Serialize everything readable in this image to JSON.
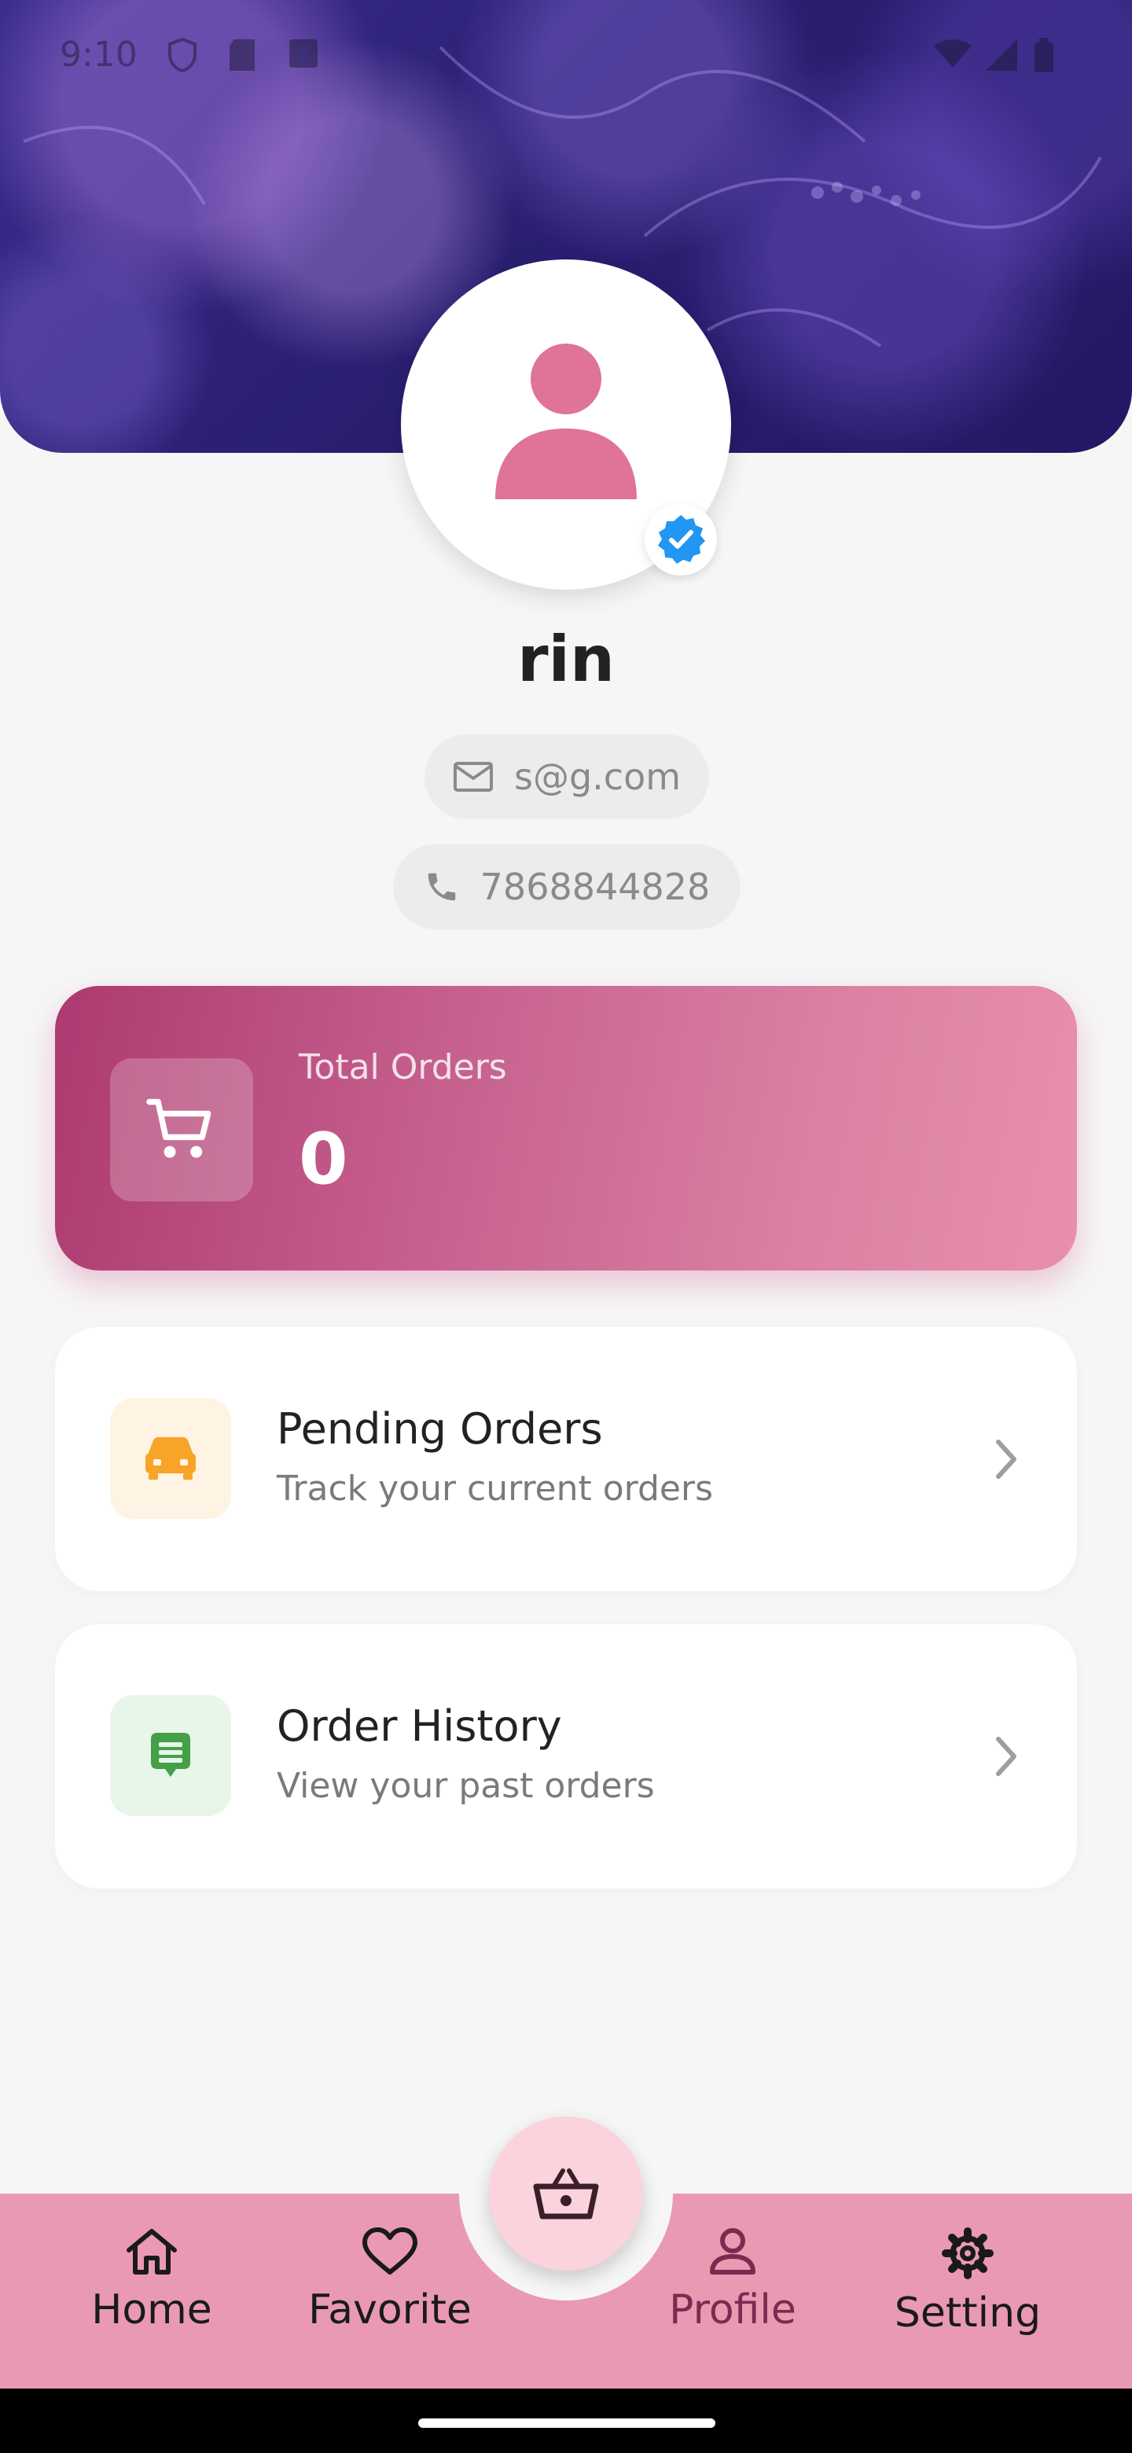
{
  "status_bar": {
    "time": "9:10"
  },
  "profile": {
    "name": "rin",
    "email": "s@g.com",
    "phone": "7868844828"
  },
  "total_orders": {
    "label": "Total Orders",
    "value": "0"
  },
  "menu": [
    {
      "title": "Pending Orders",
      "subtitle": "Track your current orders",
      "icon": "car-icon",
      "icon_color": "#f7a428",
      "icon_bg": "#fff3e3"
    },
    {
      "title": "Order History",
      "subtitle": "View your past orders",
      "icon": "receipt-icon",
      "icon_color": "#43a047",
      "icon_bg": "#e8f5e9"
    }
  ],
  "bottom_nav": {
    "items": [
      {
        "label": "Home",
        "icon": "home-icon"
      },
      {
        "label": "Favorite",
        "icon": "heart-icon"
      },
      {
        "label": "Profile",
        "icon": "person-icon",
        "active": true
      },
      {
        "label": "Setting",
        "icon": "gear-icon"
      }
    ],
    "center_icon": "basket-icon"
  },
  "colors": {
    "accent": "#e99ab2",
    "card_gradient_start": "#ad3a70",
    "card_gradient_end": "#e890ab",
    "avatar_pink": "#e0739a",
    "verified_blue": "#2196f3",
    "active_nav": "#7d2a50"
  }
}
